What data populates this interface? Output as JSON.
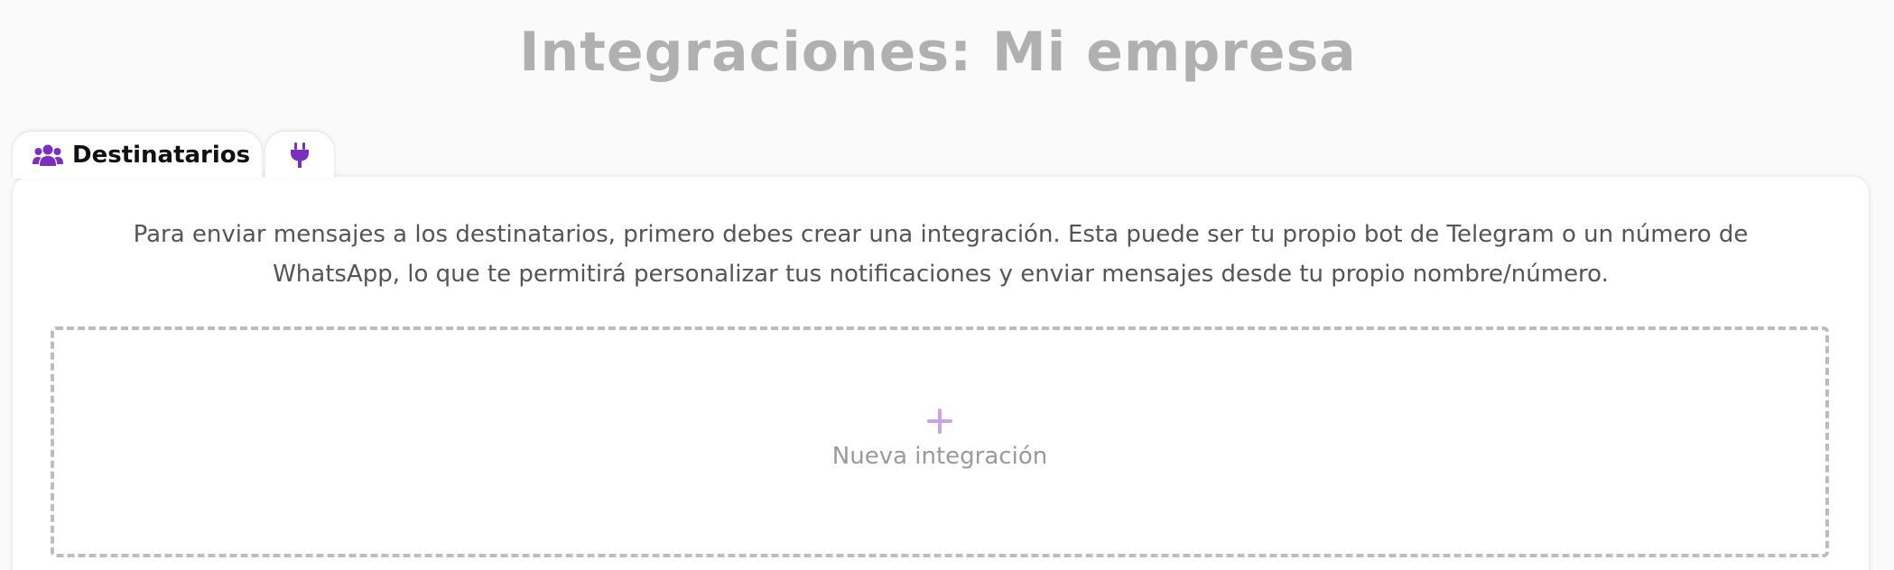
{
  "header": {
    "title": "Integraciones: Mi empresa"
  },
  "tabs": [
    {
      "label": "Destinatarios",
      "icon": "users-icon",
      "active": true
    },
    {
      "label": "",
      "icon": "plug-icon",
      "active": false
    }
  ],
  "main": {
    "intro": "Para enviar mensajes a los destinatarios, primero debes crear una integración. Esta puede ser tu propio bot de Telegram o un número de WhatsApp, lo que te permitirá personalizar tus notificaciones y enviar mensajes desde tu propio nombre/número.",
    "new_integration_label": "Nueva integración",
    "new_integration_icon": "plus-icon"
  },
  "colors": {
    "accent": "#7b2fbe",
    "title": "#b0b0b0",
    "plus": "#c9a3e6"
  }
}
